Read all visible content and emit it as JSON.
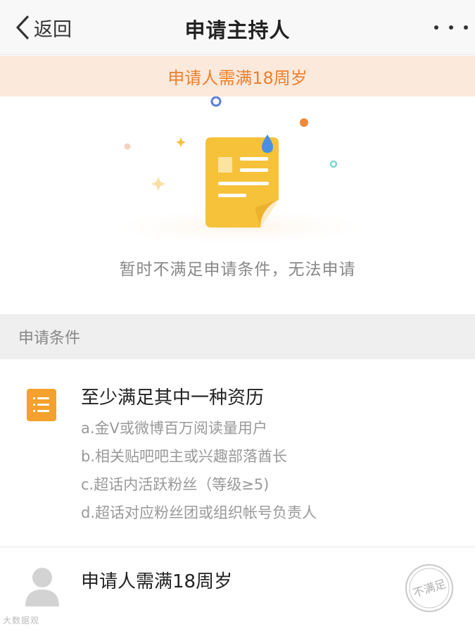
{
  "nav": {
    "back_label": "返回",
    "title": "申请主持人"
  },
  "banner": {
    "text": "申请人需满18周岁"
  },
  "hero": {
    "message": "暂时不满足申请条件，无法申请"
  },
  "conditions": {
    "section_title": "申请条件",
    "requirement": {
      "title": "至少满足其中一种资历",
      "items": [
        "a.金V或微博百万阅读量用户",
        "b.相关贴吧吧主或兴趣部落酋长",
        "c.超话内活跃粉丝（等级≥5)",
        "d.超话对应粉丝团或组织帐号负责人"
      ]
    },
    "age": {
      "title": "申请人需满18周岁",
      "status_stamp": "不满足"
    }
  },
  "watermark": "大数据观",
  "colors": {
    "accent_orange": "#f07f2a",
    "banner_bg": "#fbe9dc",
    "doc_yellow": "#f6c23a",
    "icon_orange": "#f4a12d"
  }
}
